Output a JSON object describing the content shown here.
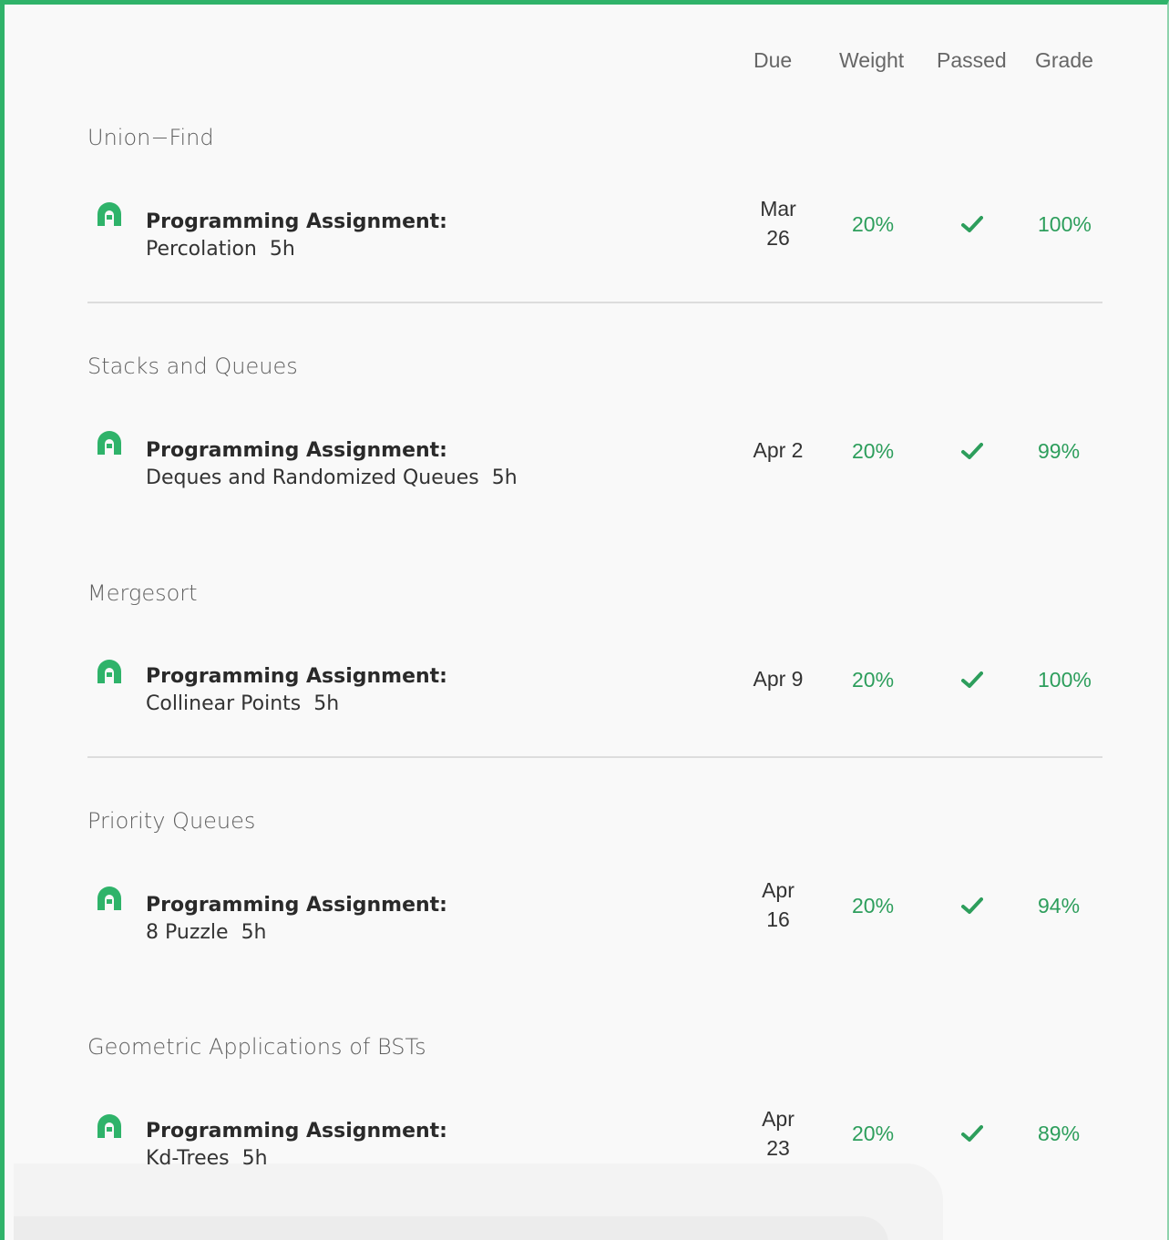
{
  "headers": {
    "due": "Due",
    "weight": "Weight",
    "passed": "Passed",
    "grade": "Grade"
  },
  "colors": {
    "accent": "#2fb36a",
    "green_text": "#2d9e5c"
  },
  "sections": [
    {
      "title": "Union−Find",
      "item": {
        "icon": "programming-assignment-icon",
        "type": "Programming Assignment:",
        "name": "Percolation",
        "duration": "5h",
        "due_line1": "Mar",
        "due_line2": "26",
        "weight": "20%",
        "passed": true,
        "grade": "100%"
      }
    },
    {
      "title": "Stacks and Queues",
      "item": {
        "icon": "programming-assignment-icon",
        "type": "Programming Assignment:",
        "name": "Deques and Randomized Queues",
        "duration": "5h",
        "due_line1": "Apr 2",
        "due_line2": "",
        "weight": "20%",
        "passed": true,
        "grade": "99%"
      }
    },
    {
      "title": "Mergesort",
      "item": {
        "icon": "programming-assignment-icon",
        "type": "Programming Assignment:",
        "name": "Collinear Points",
        "duration": "5h",
        "due_line1": "Apr 9",
        "due_line2": "",
        "weight": "20%",
        "passed": true,
        "grade": "100%"
      }
    },
    {
      "title": "Priority Queues",
      "item": {
        "icon": "programming-assignment-icon",
        "type": "Programming Assignment:",
        "name": "8 Puzzle",
        "duration": "5h",
        "due_line1": "Apr",
        "due_line2": "16",
        "weight": "20%",
        "passed": true,
        "grade": "94%"
      }
    },
    {
      "title": "Geometric Applications of BSTs",
      "item": {
        "icon": "programming-assignment-icon",
        "type": "Programming Assignment:",
        "name": "Kd-Trees",
        "duration": "5h",
        "due_line1": "Apr",
        "due_line2": "23",
        "weight": "20%",
        "passed": true,
        "grade": "89%"
      }
    }
  ]
}
